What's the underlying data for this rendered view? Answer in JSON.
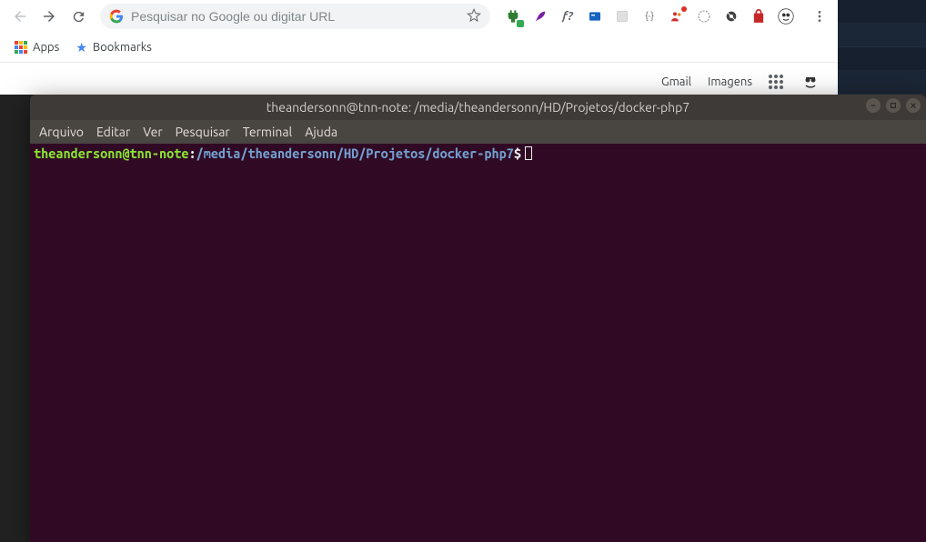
{
  "chrome": {
    "omnibox_placeholder": "Pesquisar no Google ou digitar URL",
    "bookmarks": {
      "apps_label": "Apps",
      "bookmarks_label": "Bookmarks"
    },
    "header_links": {
      "gmail": "Gmail",
      "images": "Imagens"
    },
    "ext_icons": {
      "ext1": "plug-icon",
      "ext2": "feather-icon",
      "ext3_text": "f?",
      "ext4": "card-icon",
      "ext5": "square-icon",
      "ext6_text": "{·}",
      "ext7": "people-icon",
      "ext8": "circle-icon",
      "ext9": "lens-icon",
      "ext10": "bag-icon",
      "avatar": "face-avatar"
    }
  },
  "terminal": {
    "title": "theandersonn@tnn-note: /media/theandersonn/HD/Projetos/docker-php7",
    "menu": {
      "file": "Arquivo",
      "edit": "Editar",
      "view": "Ver",
      "search": "Pesquisar",
      "terminal": "Terminal",
      "help": "Ajuda"
    },
    "prompt": {
      "user_host": "theandersonn@tnn-note",
      "colon": ":",
      "path": "/media/theandersonn/HD/Projetos/docker-php7",
      "symbol": "$"
    }
  }
}
